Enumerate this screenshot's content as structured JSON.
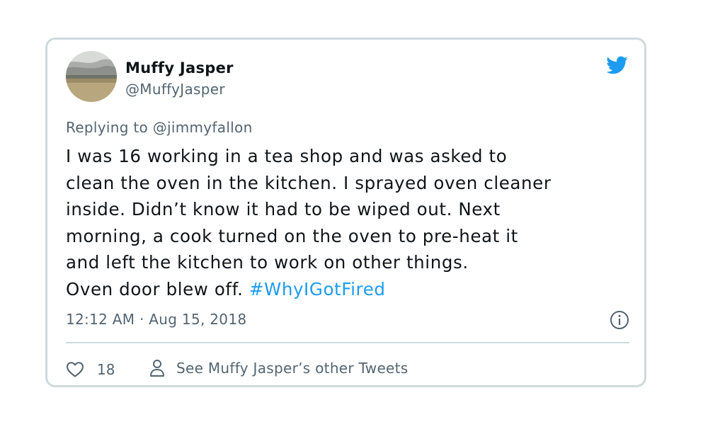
{
  "tweet": {
    "author_name": "Muffy Jasper",
    "author_handle": "@MuffyJasper",
    "avatar_icon": "landscape-photo-avatar",
    "brand_icon": "twitter-bird-icon",
    "brand_color": "#1d9bf0",
    "replying_to": "Replying to @jimmyfallon",
    "body_lines": [
      "I was 16 working in a tea shop and was asked to",
      "clean the oven in the kitchen. I sprayed oven cleaner",
      "inside. Didn’t know it had to be wiped out. Next",
      "morning, a cook turned on the oven to pre-heat it",
      "and left the kitchen to work on other things.",
      "Oven door blew off. "
    ],
    "hashtag": "#WhyIGotFired",
    "timestamp": "12:12 AM · Aug 15, 2018",
    "info_icon": "info-icon"
  },
  "actions": {
    "like_icon": "heart-icon",
    "like_count": "18",
    "profile_icon": "person-icon",
    "other_tweets_label": "See Muffy Jasper’s other Tweets"
  }
}
